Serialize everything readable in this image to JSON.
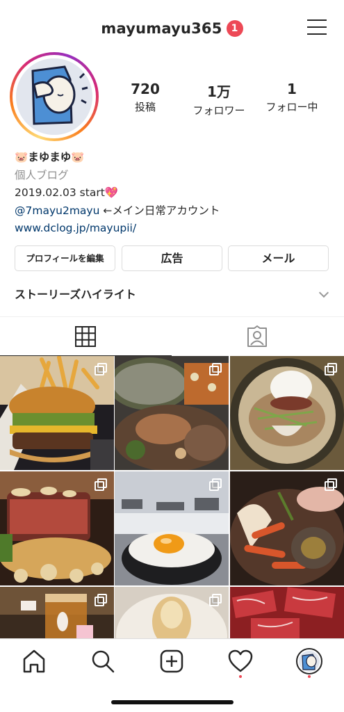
{
  "header": {
    "username": "mayumayu365",
    "notification_count": "1"
  },
  "profile": {
    "stats": [
      {
        "value": "720",
        "label": "投稿"
      },
      {
        "value": "1万",
        "label": "フォロワー"
      },
      {
        "value": "1",
        "label": "フォロー中"
      }
    ],
    "display_name": "🐷まゆまゆ🐷",
    "category": "個人ブログ",
    "bio_line1": "2019.02.03 start💖",
    "bio_mention": "@7mayu2mayu",
    "bio_mention_text": " ←メイン日常アカウント",
    "website": "www.dclog.jp/mayupii/"
  },
  "buttons": {
    "edit_profile": "プロフィールを編集",
    "ads": "広告",
    "email": "メール"
  },
  "highlights": {
    "label": "ストーリーズハイライト"
  },
  "tabs": {
    "grid_icon": "grid-icon",
    "tagged_icon": "tagged-person-icon"
  },
  "grid": {
    "posts": [
      {
        "subject": "burger-and-fries",
        "multi": true
      },
      {
        "subject": "chicken-and-rice-platter",
        "multi": true
      },
      {
        "subject": "cold-noodles-with-beef",
        "multi": true
      },
      {
        "subject": "steak-with-mushrooms",
        "multi": true
      },
      {
        "subject": "egg-on-rice-snowy-village",
        "multi": true
      },
      {
        "subject": "seafood-hotpot",
        "multi": true
      },
      {
        "subject": "iced-tea-with-bunny",
        "multi": true
      },
      {
        "subject": "pork-cutlet",
        "multi": true
      },
      {
        "subject": "wagyu-beef-slices",
        "multi": false
      }
    ]
  },
  "navbar": {
    "items": [
      "home-icon",
      "search-icon",
      "new-post-icon",
      "activity-heart-icon",
      "profile-avatar-icon"
    ]
  },
  "colors": {
    "badge": "#ed4956",
    "link": "#00376b",
    "secondary_text": "#8e8e8e"
  }
}
